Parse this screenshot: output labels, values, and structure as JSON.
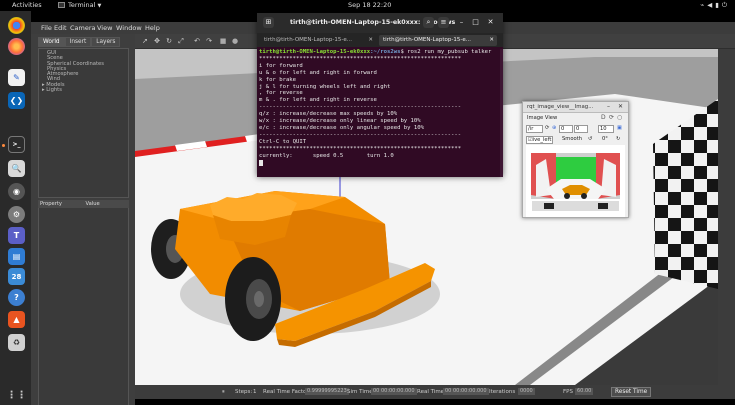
{
  "topbar": {
    "activities": "Activities",
    "app_name": "Terminal",
    "clock": "Sep 18  22:20"
  },
  "gazebo": {
    "menu": [
      "File",
      "Edit",
      "Camera",
      "View",
      "Window",
      "Help"
    ],
    "tabs": [
      "World",
      "Insert",
      "Layers"
    ],
    "tree": [
      "GUI",
      "Scene",
      "Spherical Coordinates",
      "Physics",
      "Atmosphere",
      "Wind",
      "Models",
      "Lights"
    ],
    "props_header": [
      "Property",
      "Value"
    ],
    "bottom": {
      "pause": "⏸",
      "steps": "Steps:",
      "steps_value": "1",
      "rtf_label": "Real Time Factor:",
      "rtf_value": "0.99999995223",
      "sim_label": "Sim Time",
      "sim_value": "00 00:00:00.000",
      "real_label": "Real Time",
      "real_value": "00 00:00:00.000",
      "iter_label": "Iterations",
      "iter_value": "0000",
      "fps_label": "FPS",
      "fps_value": "60.00",
      "reset": "Reset Time"
    }
  },
  "terminal": {
    "title": "tirth@tirth-OMEN-Laptop-15-ek0xxx: ~/ros2ws",
    "tabs": [
      "tirth@tirth-OMEN-Laptop-15-e...",
      "tirth@tirth-OMEN-Laptop-15-e..."
    ],
    "prompt_user": "tirth@tirth-OMEN-Laptop-15-ek0xxx",
    "prompt_path": ":~/ros2ws",
    "command": "$ ros2 run my_pubsub talker",
    "lines": [
      "************************************************************",
      "i for forward",
      "u & o for left and right in forward",
      "k for brake",
      "j & l for turning wheels left and right",
      ", for reverse",
      "m & . for left and right in reverse",
      "------------------------------------------------------------",
      "q/z : increase/decrease max speeds by 10%",
      "w/x : increase/decrease only linear speed by 10%",
      "e/c : increase/decrease only angular speed by 10%",
      "------------------------------------------------------------",
      "Ctrl-C to QUIT",
      "************************************************************",
      "",
      "currently:      speed 0.5       turn 1.0"
    ]
  },
  "rqt": {
    "title": "rqt_image_view__Imag...",
    "subtitle": "Image View",
    "topic": "/ir",
    "zoom_a": "0",
    "zoom_b": "10",
    "rotate": "0°",
    "checkbox_label": "ive_left",
    "smooth_label": "Smooth"
  }
}
